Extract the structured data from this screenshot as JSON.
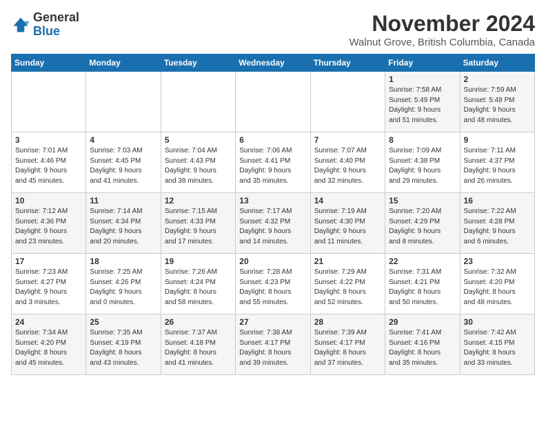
{
  "header": {
    "logo_general": "General",
    "logo_blue": "Blue",
    "month_title": "November 2024",
    "location": "Walnut Grove, British Columbia, Canada"
  },
  "weekdays": [
    "Sunday",
    "Monday",
    "Tuesday",
    "Wednesday",
    "Thursday",
    "Friday",
    "Saturday"
  ],
  "weeks": [
    [
      {
        "day": "",
        "info": ""
      },
      {
        "day": "",
        "info": ""
      },
      {
        "day": "",
        "info": ""
      },
      {
        "day": "",
        "info": ""
      },
      {
        "day": "",
        "info": ""
      },
      {
        "day": "1",
        "info": "Sunrise: 7:58 AM\nSunset: 5:49 PM\nDaylight: 9 hours\nand 51 minutes."
      },
      {
        "day": "2",
        "info": "Sunrise: 7:59 AM\nSunset: 5:48 PM\nDaylight: 9 hours\nand 48 minutes."
      }
    ],
    [
      {
        "day": "3",
        "info": "Sunrise: 7:01 AM\nSunset: 4:46 PM\nDaylight: 9 hours\nand 45 minutes."
      },
      {
        "day": "4",
        "info": "Sunrise: 7:03 AM\nSunset: 4:45 PM\nDaylight: 9 hours\nand 41 minutes."
      },
      {
        "day": "5",
        "info": "Sunrise: 7:04 AM\nSunset: 4:43 PM\nDaylight: 9 hours\nand 38 minutes."
      },
      {
        "day": "6",
        "info": "Sunrise: 7:06 AM\nSunset: 4:41 PM\nDaylight: 9 hours\nand 35 minutes."
      },
      {
        "day": "7",
        "info": "Sunrise: 7:07 AM\nSunset: 4:40 PM\nDaylight: 9 hours\nand 32 minutes."
      },
      {
        "day": "8",
        "info": "Sunrise: 7:09 AM\nSunset: 4:38 PM\nDaylight: 9 hours\nand 29 minutes."
      },
      {
        "day": "9",
        "info": "Sunrise: 7:11 AM\nSunset: 4:37 PM\nDaylight: 9 hours\nand 26 minutes."
      }
    ],
    [
      {
        "day": "10",
        "info": "Sunrise: 7:12 AM\nSunset: 4:36 PM\nDaylight: 9 hours\nand 23 minutes."
      },
      {
        "day": "11",
        "info": "Sunrise: 7:14 AM\nSunset: 4:34 PM\nDaylight: 9 hours\nand 20 minutes."
      },
      {
        "day": "12",
        "info": "Sunrise: 7:15 AM\nSunset: 4:33 PM\nDaylight: 9 hours\nand 17 minutes."
      },
      {
        "day": "13",
        "info": "Sunrise: 7:17 AM\nSunset: 4:32 PM\nDaylight: 9 hours\nand 14 minutes."
      },
      {
        "day": "14",
        "info": "Sunrise: 7:19 AM\nSunset: 4:30 PM\nDaylight: 9 hours\nand 11 minutes."
      },
      {
        "day": "15",
        "info": "Sunrise: 7:20 AM\nSunset: 4:29 PM\nDaylight: 9 hours\nand 8 minutes."
      },
      {
        "day": "16",
        "info": "Sunrise: 7:22 AM\nSunset: 4:28 PM\nDaylight: 9 hours\nand 6 minutes."
      }
    ],
    [
      {
        "day": "17",
        "info": "Sunrise: 7:23 AM\nSunset: 4:27 PM\nDaylight: 9 hours\nand 3 minutes."
      },
      {
        "day": "18",
        "info": "Sunrise: 7:25 AM\nSunset: 4:26 PM\nDaylight: 9 hours\nand 0 minutes."
      },
      {
        "day": "19",
        "info": "Sunrise: 7:26 AM\nSunset: 4:24 PM\nDaylight: 8 hours\nand 58 minutes."
      },
      {
        "day": "20",
        "info": "Sunrise: 7:28 AM\nSunset: 4:23 PM\nDaylight: 8 hours\nand 55 minutes."
      },
      {
        "day": "21",
        "info": "Sunrise: 7:29 AM\nSunset: 4:22 PM\nDaylight: 8 hours\nand 52 minutes."
      },
      {
        "day": "22",
        "info": "Sunrise: 7:31 AM\nSunset: 4:21 PM\nDaylight: 8 hours\nand 50 minutes."
      },
      {
        "day": "23",
        "info": "Sunrise: 7:32 AM\nSunset: 4:20 PM\nDaylight: 8 hours\nand 48 minutes."
      }
    ],
    [
      {
        "day": "24",
        "info": "Sunrise: 7:34 AM\nSunset: 4:20 PM\nDaylight: 8 hours\nand 45 minutes."
      },
      {
        "day": "25",
        "info": "Sunrise: 7:35 AM\nSunset: 4:19 PM\nDaylight: 8 hours\nand 43 minutes."
      },
      {
        "day": "26",
        "info": "Sunrise: 7:37 AM\nSunset: 4:18 PM\nDaylight: 8 hours\nand 41 minutes."
      },
      {
        "day": "27",
        "info": "Sunrise: 7:38 AM\nSunset: 4:17 PM\nDaylight: 8 hours\nand 39 minutes."
      },
      {
        "day": "28",
        "info": "Sunrise: 7:39 AM\nSunset: 4:17 PM\nDaylight: 8 hours\nand 37 minutes."
      },
      {
        "day": "29",
        "info": "Sunrise: 7:41 AM\nSunset: 4:16 PM\nDaylight: 8 hours\nand 35 minutes."
      },
      {
        "day": "30",
        "info": "Sunrise: 7:42 AM\nSunset: 4:15 PM\nDaylight: 8 hours\nand 33 minutes."
      }
    ]
  ]
}
